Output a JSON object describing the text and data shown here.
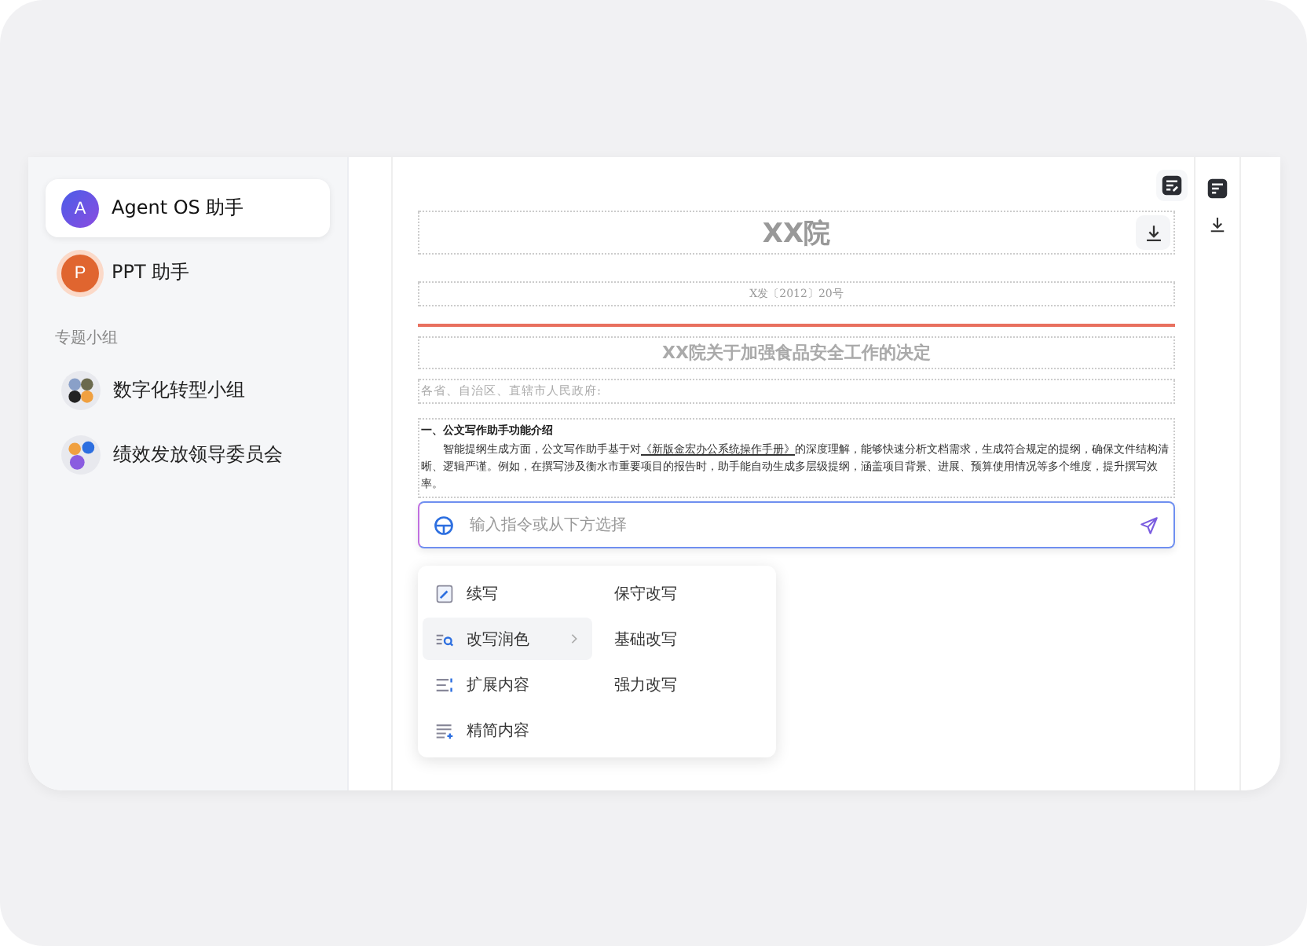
{
  "sidebar": {
    "items": [
      {
        "kind": "agent",
        "label": "Agent OS 助手",
        "avatar": "A",
        "selected": true
      },
      {
        "kind": "ppt",
        "label": "PPT 助手",
        "avatar": "P",
        "selected": false
      }
    ],
    "section_title": "专题小组",
    "groups": [
      {
        "kind": "group4",
        "label": "数字化转型小组"
      },
      {
        "kind": "group3",
        "label": "绩效发放领导委员会"
      }
    ]
  },
  "document": {
    "title": "XX院",
    "doc_number": "X发〔2012〕20号",
    "heading": "XX院关于加强食品安全工作的决定",
    "recipient": "各省、自治区、直辖市人民政府:",
    "section_heading": "一、公文写作助手功能介绍",
    "paragraph": [
      {
        "kind": "text",
        "text": "智能提纲生成方面，公文写作助手基于对"
      },
      {
        "kind": "link",
        "text": "《新版金宏办公系统操作手册》"
      },
      {
        "kind": "text",
        "text": "的深度理解，能够快速分析文档需求，生成符合规定的提纲，确保文件结构清晰、逻辑严谨。例如，在撰写涉及衡水市重要项目的报告时，助手能自动生成多层级提纲，涵盖项目背景、进展、预算使用情况等多个维度，提升撰写效率。"
      }
    ]
  },
  "prompt": {
    "placeholder": "输入指令或从下方选择"
  },
  "menu": {
    "items": [
      {
        "kind": "continue",
        "label": "续写",
        "selected": false
      },
      {
        "kind": "rewrite",
        "label": "改写润色",
        "selected": true
      },
      {
        "kind": "expand",
        "label": "扩展内容",
        "selected": false
      },
      {
        "kind": "simplify",
        "label": "精简内容",
        "selected": false
      }
    ],
    "submenu": [
      "保守改写",
      "基础改写",
      "强力改写"
    ]
  }
}
